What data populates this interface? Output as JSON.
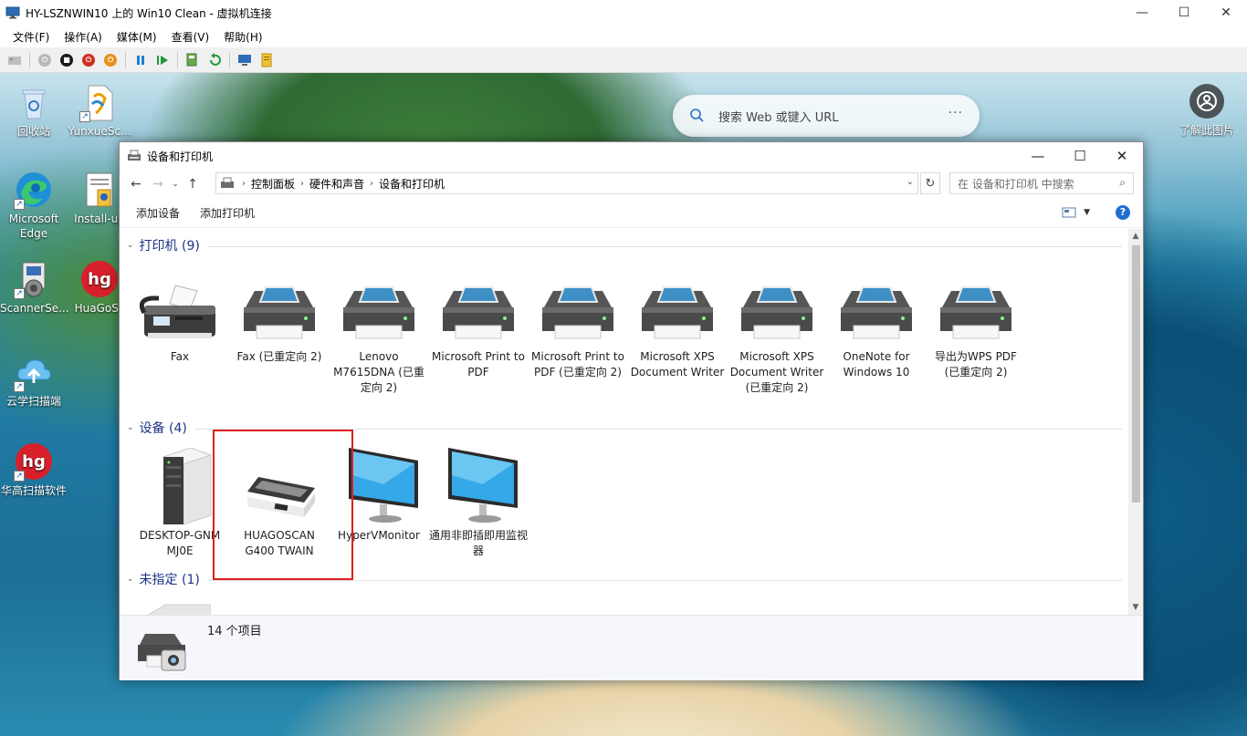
{
  "host": {
    "title": "HY-LSZNWIN10 上的 Win10 Clean - 虚拟机连接",
    "menu": [
      "文件(F)",
      "操作(A)",
      "媒体(M)",
      "查看(V)",
      "帮助(H)"
    ]
  },
  "desktop": {
    "icons": [
      {
        "label": "回收站"
      },
      {
        "label": "YunxueSc..."
      },
      {
        "label": "Microsoft Edge"
      },
      {
        "label": "Install-up"
      },
      {
        "label": "ScannerSe..."
      },
      {
        "label": "HuaGoSc"
      },
      {
        "label": "云学扫描端"
      },
      {
        "label": "华高扫描软件"
      }
    ],
    "web_search_placeholder": "搜索 Web 或键入 URL",
    "web_search_more": "···",
    "learn_more_label": "了解此图片"
  },
  "explorer": {
    "title": "设备和打印机",
    "breadcrumb": [
      "控制面板",
      "硬件和声音",
      "设备和打印机"
    ],
    "search_placeholder": "在 设备和打印机 中搜索",
    "commands": [
      "添加设备",
      "添加打印机"
    ],
    "help": "?",
    "groups": {
      "printers": {
        "title": "打印机 (9)",
        "items": [
          {
            "label": "Fax"
          },
          {
            "label": "Fax (已重定向 2)"
          },
          {
            "label": "Lenovo M7615DNA (已重定向 2)"
          },
          {
            "label": "Microsoft Print to PDF"
          },
          {
            "label": "Microsoft Print to PDF (已重定向 2)"
          },
          {
            "label": "Microsoft XPS Document Writer"
          },
          {
            "label": "Microsoft XPS Document Writer (已重定向 2)"
          },
          {
            "label": "OneNote for Windows 10"
          },
          {
            "label": "导出为WPS PDF (已重定向 2)"
          }
        ]
      },
      "devices": {
        "title": "设备 (4)",
        "items": [
          {
            "label": "DESKTOP-GNM MJ0E"
          },
          {
            "label": "HUAGOSCAN G400 TWAIN"
          },
          {
            "label": "HyperVMonitor"
          },
          {
            "label": "通用非即插即用监视器"
          }
        ]
      },
      "unspecified": {
        "title": "未指定 (1)"
      }
    },
    "details": {
      "count_text": "14 个项目"
    }
  },
  "colors": {
    "group_title": "#1e3287",
    "highlight": "#e02020",
    "help_blue": "#1f6fd1"
  }
}
